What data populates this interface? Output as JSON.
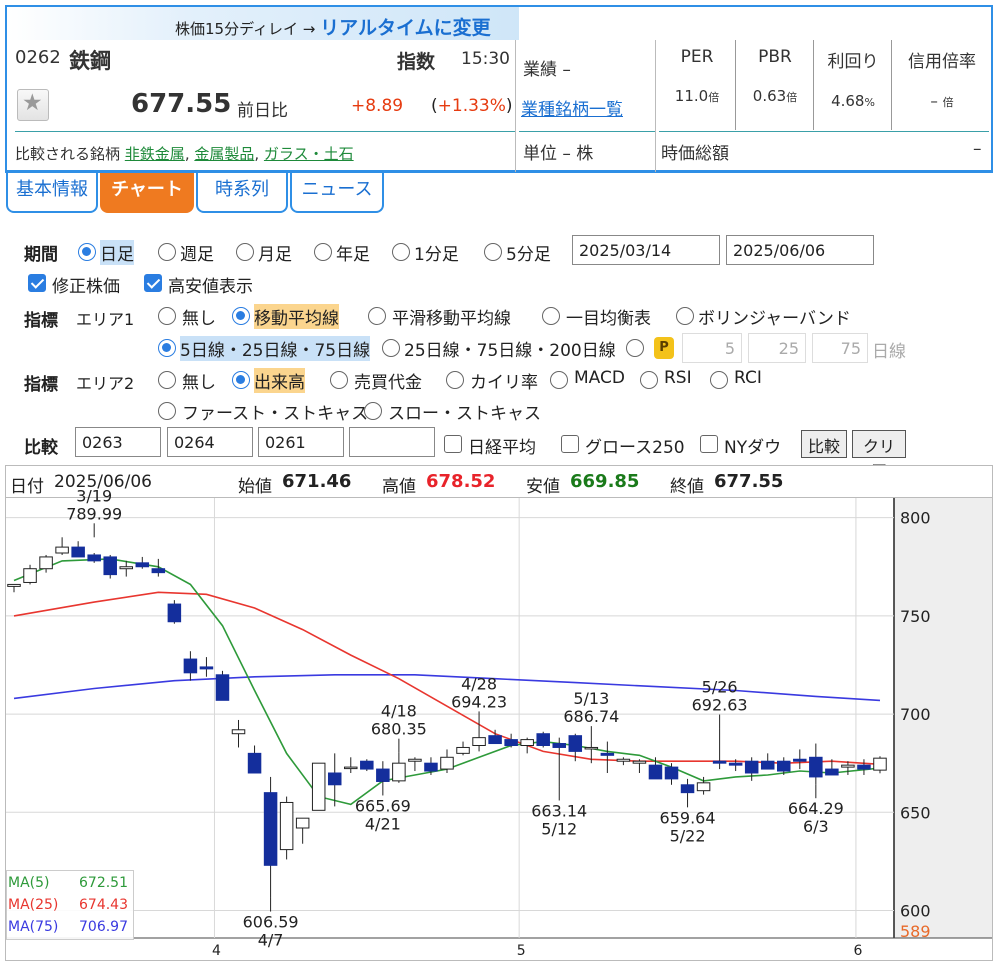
{
  "header": {
    "delay_text": "株価15分ディレイ →",
    "realtime_link": "リアルタイムに変更",
    "code": "0262",
    "name": "鉄鋼",
    "index_label": "指数",
    "time": "15:30",
    "price": "677.55",
    "prev_label": "前日比",
    "change": "+8.89",
    "change_pct_value": "+1.33%",
    "compare_label": "比較される銘柄",
    "compare_links": [
      "非鉄金属",
      "金属製品",
      "ガラス・土石"
    ],
    "perf_label": "業績 –",
    "sector_link": "業種銘柄一覧",
    "unit_label": "単位 – 株",
    "metrics": [
      {
        "label": "PER",
        "value": "11.0",
        "unit": "倍"
      },
      {
        "label": "PBR",
        "value": "0.63",
        "unit": "倍"
      },
      {
        "label": "利回り",
        "value": "4.68",
        "unit": "%"
      },
      {
        "label": "信用倍率",
        "value": "–",
        "unit": "倍"
      }
    ],
    "market_cap_label": "時価総額",
    "market_cap_value": "–"
  },
  "tabs": [
    "基本情報",
    "チャート",
    "時系列",
    "ニュース"
  ],
  "controls": {
    "period_label": "期間",
    "period_options": [
      "日足",
      "週足",
      "月足",
      "年足",
      "1分足",
      "5分足"
    ],
    "date_from": "2025/03/14",
    "date_to": "2025/06/06",
    "adjusted_label": "修正株価",
    "highlow_label": "高安値表示",
    "indicator_label": "指標",
    "area1_label": "エリア1",
    "area1_options": [
      "無し",
      "移動平均線",
      "平滑移動平均線",
      "一目均衡表",
      "ボリンジャーバンド"
    ],
    "ma_sets": [
      "5日線・25日線・75日線",
      "25日線・75日線・200日線"
    ],
    "custom_ma": [
      "5",
      "25",
      "75"
    ],
    "custom_ma_unit": "日線",
    "area2_label": "エリア2",
    "area2_options": [
      "無し",
      "出来高",
      "売買代金",
      "カイリ率",
      "MACD",
      "RSI",
      "RCI"
    ],
    "area2_options_row2": [
      "ファースト・ストキャス",
      "スロー・ストキャス"
    ],
    "compare_label": "比較",
    "compare_codes": [
      "0263",
      "0264",
      "0261",
      ""
    ],
    "compare_checks": [
      "日経平均",
      "グロース250",
      "NYダウ"
    ],
    "compare_button": "比較",
    "clear_button": "クリア"
  },
  "chart": {
    "date_label": "日付",
    "date": "2025/06/06",
    "open_label": "始値",
    "open": "671.46",
    "high_label": "高値",
    "high": "678.52",
    "low_label": "安値",
    "low": "669.85",
    "close_label": "終値",
    "close": "677.55",
    "colors": {
      "high": "#e8232a",
      "low": "#1a7a1a",
      "ma5": "#2e9a3a",
      "ma25": "#e8362f",
      "ma75": "#3a3ae0",
      "candle_down": "#142e9c"
    },
    "legend": [
      {
        "name": "MA(5)",
        "value": "672.51"
      },
      {
        "name": "MA(25)",
        "value": "674.43"
      },
      {
        "name": "MA(75)",
        "value": "706.97"
      }
    ],
    "bottom_right_value": "589"
  },
  "chart_data": {
    "type": "candlestick",
    "y_ticks": [
      800,
      750,
      700,
      650,
      600
    ],
    "ylim": [
      586,
      810
    ],
    "month_labels": [
      "4",
      "5",
      "6"
    ],
    "annotations": [
      {
        "date": "3/19",
        "value": "789.99",
        "kind": "high"
      },
      {
        "date": "4/7",
        "value": "606.59",
        "kind": "low"
      },
      {
        "date": "4/18",
        "value": "680.35",
        "kind": "high"
      },
      {
        "date": "4/21",
        "value": "665.69",
        "kind": "low"
      },
      {
        "date": "4/28",
        "value": "694.23",
        "kind": "high"
      },
      {
        "date": "5/13",
        "value": "686.74",
        "kind": "high"
      },
      {
        "date": "5/12",
        "value": "663.14",
        "kind": "low"
      },
      {
        "date": "5/26",
        "value": "692.63",
        "kind": "high"
      },
      {
        "date": "5/22",
        "value": "659.64",
        "kind": "low"
      },
      {
        "date": "6/3",
        "value": "664.29",
        "kind": "low"
      }
    ],
    "candles": [
      [
        765,
        766,
        762,
        766
      ],
      [
        767,
        776,
        766,
        774
      ],
      [
        774,
        781,
        772,
        780
      ],
      [
        782,
        790,
        781,
        785
      ],
      [
        785,
        788,
        780,
        780
      ],
      [
        781,
        782,
        777,
        778
      ],
      [
        780,
        781,
        769,
        771
      ],
      [
        774,
        778,
        770,
        775
      ],
      [
        777,
        780,
        774,
        775
      ],
      [
        774,
        779,
        770,
        772
      ],
      [
        756,
        758,
        746,
        747
      ],
      [
        728,
        732,
        717,
        721
      ],
      [
        724,
        729,
        719,
        723
      ],
      [
        720,
        722,
        708,
        707
      ],
      [
        690,
        697,
        683,
        692
      ],
      [
        680,
        684,
        670,
        670
      ],
      [
        660,
        668,
        606.59,
        623
      ],
      [
        631,
        658,
        626,
        655
      ],
      [
        642,
        647,
        634,
        647
      ],
      [
        651,
        669,
        651,
        675
      ],
      [
        670,
        680,
        653,
        664
      ],
      [
        673,
        678,
        670,
        673
      ],
      [
        676,
        677,
        671,
        672
      ],
      [
        672,
        676,
        666,
        665.69
      ],
      [
        666,
        680.35,
        665,
        675
      ],
      [
        676,
        678,
        671,
        677
      ],
      [
        675,
        678,
        669,
        671
      ],
      [
        672,
        682,
        670,
        678
      ],
      [
        680,
        686,
        679,
        683
      ],
      [
        684,
        694.23,
        681,
        688
      ],
      [
        689,
        692,
        685,
        685
      ],
      [
        687,
        690,
        683,
        684
      ],
      [
        684,
        688,
        680,
        687
      ],
      [
        690,
        691,
        683,
        684
      ],
      [
        685,
        688,
        663.14,
        683
      ],
      [
        689,
        690,
        676,
        681
      ],
      [
        683,
        686.74,
        675,
        683
      ],
      [
        680,
        686,
        670,
        679
      ],
      [
        676,
        678,
        674,
        677
      ],
      [
        675,
        677,
        670,
        676
      ],
      [
        674,
        678,
        670,
        667
      ],
      [
        673,
        675,
        664,
        667
      ],
      [
        664,
        667,
        659.64,
        660
      ],
      [
        661,
        668,
        659,
        665
      ],
      [
        676,
        692.63,
        672,
        675
      ],
      [
        675,
        677,
        671,
        674
      ],
      [
        676,
        678,
        666,
        670
      ],
      [
        676,
        680,
        672,
        672
      ],
      [
        676,
        678,
        669,
        671
      ],
      [
        677,
        682,
        672,
        676
      ],
      [
        678,
        685,
        664.29,
        668
      ],
      [
        672,
        677,
        670,
        669
      ],
      [
        673,
        676,
        669,
        674
      ],
      [
        674,
        677,
        669,
        672
      ],
      [
        671.46,
        678.52,
        669.85,
        677.55
      ]
    ],
    "ma5_curve": [
      [
        0,
        768
      ],
      [
        3,
        778
      ],
      [
        6,
        779
      ],
      [
        9,
        775
      ],
      [
        11,
        766
      ],
      [
        13,
        745
      ],
      [
        15,
        712
      ],
      [
        17,
        680
      ],
      [
        19,
        658
      ],
      [
        21,
        654
      ],
      [
        23,
        666
      ],
      [
        25,
        669
      ],
      [
        27,
        672
      ],
      [
        29,
        678
      ],
      [
        31,
        684
      ],
      [
        33,
        686
      ],
      [
        35,
        684
      ],
      [
        37,
        681
      ],
      [
        39,
        679
      ],
      [
        41,
        673
      ],
      [
        43,
        666
      ],
      [
        45,
        668
      ],
      [
        47,
        669
      ],
      [
        49,
        671
      ],
      [
        51,
        670
      ],
      [
        54,
        672.51
      ]
    ],
    "ma25_curve": [
      [
        0,
        750
      ],
      [
        5,
        757
      ],
      [
        9,
        762
      ],
      [
        12,
        761
      ],
      [
        15,
        754
      ],
      [
        18,
        743
      ],
      [
        21,
        730
      ],
      [
        24,
        718
      ],
      [
        27,
        704
      ],
      [
        30,
        690
      ],
      [
        33,
        681
      ],
      [
        36,
        677
      ],
      [
        39,
        676
      ],
      [
        42,
        676
      ],
      [
        45,
        676
      ],
      [
        48,
        675
      ],
      [
        51,
        676
      ],
      [
        54,
        674.43
      ]
    ],
    "ma75_curve": [
      [
        0,
        708
      ],
      [
        5,
        713
      ],
      [
        10,
        717
      ],
      [
        15,
        719
      ],
      [
        20,
        720
      ],
      [
        25,
        720
      ],
      [
        30,
        718
      ],
      [
        35,
        716
      ],
      [
        40,
        714
      ],
      [
        45,
        712
      ],
      [
        50,
        709
      ],
      [
        54,
        706.97
      ]
    ]
  }
}
